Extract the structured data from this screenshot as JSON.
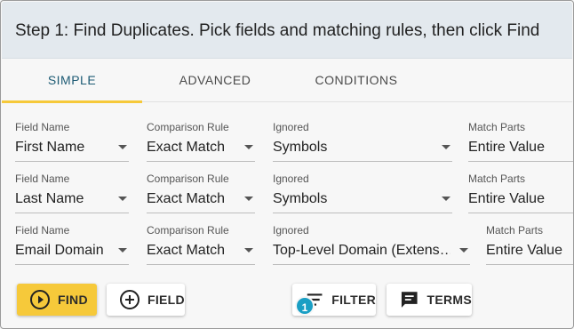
{
  "header": {
    "title": "Step 1: Find Duplicates. Pick fields and matching rules, then click Find"
  },
  "tabs": [
    {
      "label": "SIMPLE",
      "active": true
    },
    {
      "label": "ADVANCED",
      "active": false
    },
    {
      "label": "CONDITIONS",
      "active": false
    }
  ],
  "rows": [
    {
      "field_name": {
        "label": "Field Name",
        "value": "First Name"
      },
      "comparison_rule": {
        "label": "Comparison Rule",
        "value": "Exact Match"
      },
      "ignored": {
        "label": "Ignored",
        "value": "Symbols"
      },
      "match_parts": {
        "label": "Match Parts",
        "value": "Entire Value"
      }
    },
    {
      "field_name": {
        "label": "Field Name",
        "value": "Last Name"
      },
      "comparison_rule": {
        "label": "Comparison Rule",
        "value": "Exact Match"
      },
      "ignored": {
        "label": "Ignored",
        "value": "Symbols"
      },
      "match_parts": {
        "label": "Match Parts",
        "value": "Entire Value"
      }
    },
    {
      "field_name": {
        "label": "Field Name",
        "value": "Email Domain"
      },
      "comparison_rule": {
        "label": "Comparison Rule",
        "value": "Exact Match"
      },
      "ignored": {
        "label": "Ignored",
        "value": "Top-Level Domain (Extens…"
      },
      "match_parts": {
        "label": "Match Parts",
        "value": "Entire Value"
      }
    }
  ],
  "buttons": {
    "find": {
      "label": "FIND",
      "icon": "play-circle-icon"
    },
    "field": {
      "label": "FIELD",
      "icon": "add-circle-icon"
    },
    "filter": {
      "label": "FILTER",
      "icon": "filter-icon",
      "badge": "1"
    },
    "terms": {
      "label": "TERMS",
      "icon": "comment-icon"
    }
  },
  "colors": {
    "header_bg": "#e3e9ee",
    "accent_yellow": "#f6c93a",
    "active_tab_text": "#1d5b74",
    "badge_blue": "#1a9fc4"
  }
}
